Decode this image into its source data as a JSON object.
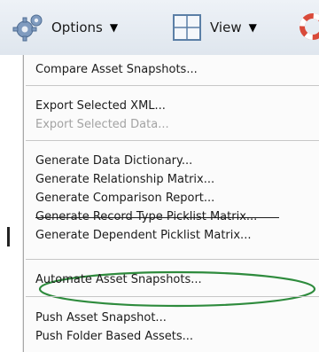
{
  "toolbar": {
    "options_label": "Options",
    "view_label": "View",
    "icons": [
      "gear-icon",
      "grid-view-icon",
      "lifebuoy-icon"
    ]
  },
  "menu": {
    "items": [
      {
        "label": "Compare Asset Snapshots...",
        "enabled": true
      },
      {
        "label": "Export Selected XML...",
        "enabled": true
      },
      {
        "label": "Export Selected Data...",
        "enabled": false
      },
      {
        "label": "Generate Data Dictionary...",
        "enabled": true
      },
      {
        "label": "Generate Relationship Matrix...",
        "enabled": true
      },
      {
        "label": "Generate Comparison Report...",
        "enabled": true
      },
      {
        "label": "Generate Record Type Picklist Matrix...",
        "enabled": true
      },
      {
        "label": "Generate Dependent Picklist Matrix...",
        "enabled": true,
        "highlighted": true
      },
      {
        "label": "Automate Asset Snapshots...",
        "enabled": true
      },
      {
        "label": "Push Asset Snapshot...",
        "enabled": true
      },
      {
        "label": "Push Folder Based Assets...",
        "enabled": true
      }
    ]
  },
  "colors": {
    "highlight_ellipse": "#2e8b3d",
    "disabled_text": "#a3a3a3"
  }
}
